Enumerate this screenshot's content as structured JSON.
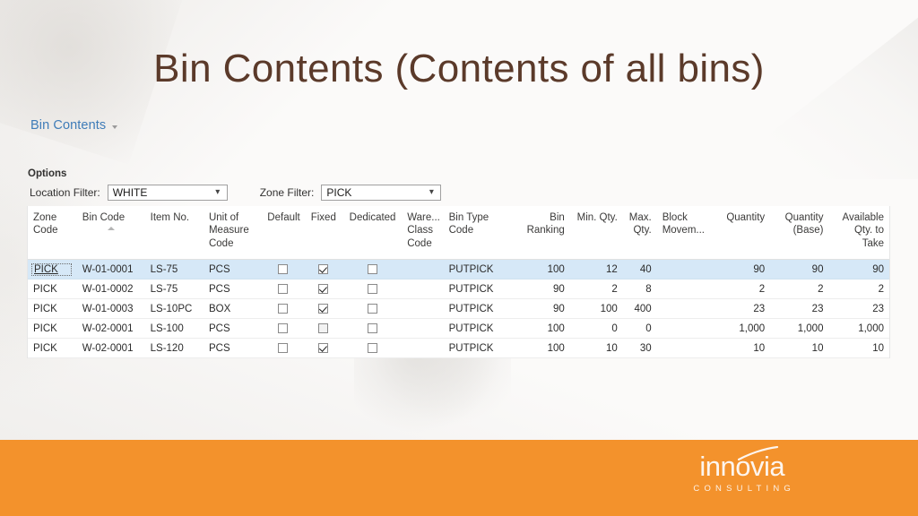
{
  "slide": {
    "title": "Bin Contents (Contents of all bins)",
    "title_color": "#5b3a2a",
    "background_color": "#fbfaf9",
    "footer_color": "#f3922c"
  },
  "breadcrumb": {
    "link": "Bin Contents",
    "caret_icon": "chevron-down-icon"
  },
  "options": {
    "section_label": "Options",
    "location_filter": {
      "label": "Location Filter:",
      "value": "WHITE",
      "placeholder": "",
      "chevron_icon": "chevron-down-icon"
    },
    "zone_filter": {
      "label": "Zone Filter:",
      "value": "PICK",
      "placeholder": "",
      "chevron_icon": "chevron-down-icon"
    }
  },
  "grid": {
    "sorted_column": "Bin Code",
    "sort_direction": "ascending",
    "selected_row_index": 0,
    "selection_color": "#d6e8f7",
    "columns": [
      {
        "key": "zone_code",
        "label": "Zone Code",
        "align": "left"
      },
      {
        "key": "bin_code",
        "label": "Bin Code",
        "align": "left"
      },
      {
        "key": "item_no",
        "label": "Item No.",
        "align": "left"
      },
      {
        "key": "uom_code",
        "label": "Unit of Measure Code",
        "align": "left"
      },
      {
        "key": "default",
        "label": "Default",
        "align": "center"
      },
      {
        "key": "fixed",
        "label": "Fixed",
        "align": "center"
      },
      {
        "key": "dedicated",
        "label": "Dedicated",
        "align": "center"
      },
      {
        "key": "ware_class",
        "label": "Ware... Class Code",
        "align": "left"
      },
      {
        "key": "bin_type_code",
        "label": "Bin Type Code",
        "align": "left"
      },
      {
        "key": "bin_ranking",
        "label": "Bin Ranking",
        "align": "right"
      },
      {
        "key": "min_qty",
        "label": "Min. Qty.",
        "align": "right"
      },
      {
        "key": "max_qty",
        "label": "Max. Qty.",
        "align": "right"
      },
      {
        "key": "block_movem",
        "label": "Block Movem...",
        "align": "left"
      },
      {
        "key": "quantity",
        "label": "Quantity",
        "align": "right"
      },
      {
        "key": "quantity_base",
        "label": "Quantity (Base)",
        "align": "right"
      },
      {
        "key": "available_qty",
        "label": "Available Qty. to Take",
        "align": "right"
      }
    ],
    "rows": [
      {
        "zone_code": "PICK",
        "bin_code": "W-01-0001",
        "item_no": "LS-75",
        "uom_code": "PCS",
        "default": false,
        "fixed": true,
        "dedicated": false,
        "ware_class": "",
        "bin_type_code": "PUTPICK",
        "bin_ranking": "100",
        "min_qty": "12",
        "max_qty": "40",
        "block_movem": "",
        "quantity": "90",
        "quantity_base": "90",
        "available_qty": "90"
      },
      {
        "zone_code": "PICK",
        "bin_code": "W-01-0002",
        "item_no": "LS-75",
        "uom_code": "PCS",
        "default": false,
        "fixed": true,
        "dedicated": false,
        "ware_class": "",
        "bin_type_code": "PUTPICK",
        "bin_ranking": "90",
        "min_qty": "2",
        "max_qty": "8",
        "block_movem": "",
        "quantity": "2",
        "quantity_base": "2",
        "available_qty": "2"
      },
      {
        "zone_code": "PICK",
        "bin_code": "W-01-0003",
        "item_no": "LS-10PC",
        "uom_code": "BOX",
        "default": false,
        "fixed": true,
        "dedicated": false,
        "ware_class": "",
        "bin_type_code": "PUTPICK",
        "bin_ranking": "90",
        "min_qty": "100",
        "max_qty": "400",
        "block_movem": "",
        "quantity": "23",
        "quantity_base": "23",
        "available_qty": "23"
      },
      {
        "zone_code": "PICK",
        "bin_code": "W-02-0001",
        "item_no": "LS-100",
        "uom_code": "PCS",
        "default": false,
        "fixed": false,
        "dedicated": false,
        "ware_class": "",
        "bin_type_code": "PUTPICK",
        "bin_ranking": "100",
        "min_qty": "0",
        "max_qty": "0",
        "block_movem": "",
        "quantity": "1,000",
        "quantity_base": "1,000",
        "available_qty": "1,000"
      },
      {
        "zone_code": "PICK",
        "bin_code": "W-02-0001",
        "item_no": "LS-120",
        "uom_code": "PCS",
        "default": false,
        "fixed": true,
        "dedicated": false,
        "ware_class": "",
        "bin_type_code": "PUTPICK",
        "bin_ranking": "100",
        "min_qty": "10",
        "max_qty": "30",
        "block_movem": "",
        "quantity": "10",
        "quantity_base": "10",
        "available_qty": "10"
      }
    ]
  },
  "footer": {
    "logo_word": "innovia",
    "logo_sub": "CONSULTING"
  }
}
